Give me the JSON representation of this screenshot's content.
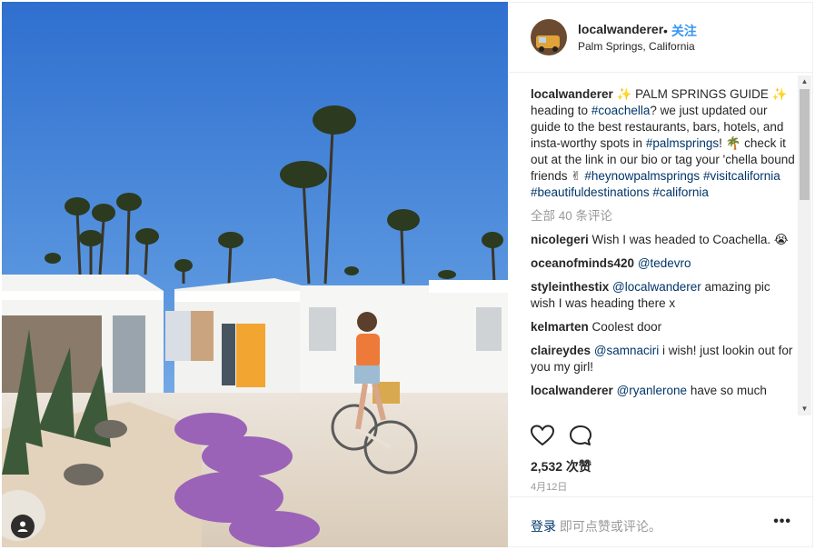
{
  "post": {
    "username": "localwanderer",
    "follow_dot": "•",
    "follow_label": "关注",
    "location": "Palm Springs, California"
  },
  "caption": {
    "username": "localwanderer",
    "t1": " ✨ PALM SPRINGS GUIDE ✨ heading to ",
    "tag1": "#coachella",
    "t2": "? we just updated our guide to the best restaurants, bars, hotels, and insta-worthy spots in ",
    "tag2": "#palmsprings",
    "t3": "! 🌴 check it out at the link in our bio or tag your 'chella bound friends ✌ ",
    "tag3": "#heynowpalmsprings",
    "tag4": "#visitcalifornia",
    "tag5": "#beautifuldestinations",
    "tag6": "#california"
  },
  "load_more": "全部 40 条评论",
  "comments": [
    {
      "user": "nicolegeri",
      "text": " Wish I was headed to Coachella. 😭"
    },
    {
      "user": "oceanofminds420",
      "mention": "@tedevro",
      "text": ""
    },
    {
      "user": "styleinthestix",
      "mention": "@localwanderer",
      "text": " amazing pic wish I was heading there x"
    },
    {
      "user": "kelmarten",
      "text": " Coolest door"
    },
    {
      "user": "claireydes",
      "mention": "@samnaciri",
      "text": " i wish! just lookin out for you my girl!"
    },
    {
      "user": "localwanderer",
      "mention": "@ryanlerone",
      "text": " have so much"
    }
  ],
  "likes_label": "2,532 次赞",
  "date": "4月12日",
  "footer": {
    "login": "登录",
    "rest": " 即可点赞或评论。",
    "more": "•••"
  },
  "scroll": {
    "up": "▲",
    "down": "▼"
  },
  "icons": {
    "heart": "heart-icon",
    "comment": "comment-icon",
    "tag": "person-tag-icon"
  },
  "colors": {
    "link": "#003569",
    "follow": "#3897f0",
    "muted": "#999999",
    "sky": "#4a86d8"
  }
}
